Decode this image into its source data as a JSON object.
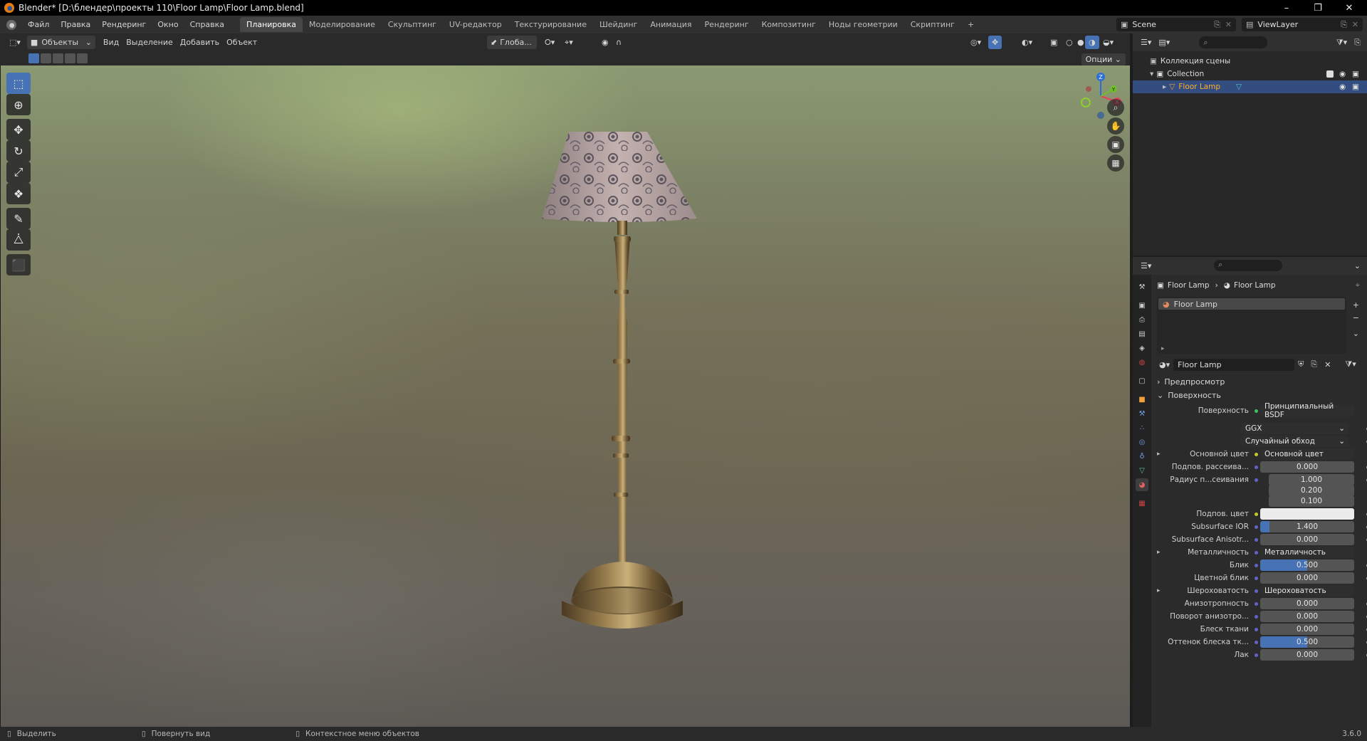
{
  "window": {
    "title": "Blender* [D:\\блендер\\проекты 110\\Floor Lamp\\Floor Lamp.blend]"
  },
  "menu": [
    "Файл",
    "Правка",
    "Рендеринг",
    "Окно",
    "Справка"
  ],
  "workspaces": [
    "Планировка",
    "Моделирование",
    "Скульптинг",
    "UV-редактор",
    "Текстурирование",
    "Шейдинг",
    "Анимация",
    "Рендеринг",
    "Композитинг",
    "Ноды геометрии",
    "Скриптинг"
  ],
  "active_workspace": "Планировка",
  "scene": {
    "name": "Scene",
    "view_layer": "ViewLayer"
  },
  "viewport_header": {
    "mode": "Объекты",
    "menus": [
      "Вид",
      "Выделение",
      "Добавить",
      "Объект"
    ],
    "orientation": "Глоба...",
    "options": "Опции"
  },
  "outliner": {
    "root": "Коллекция сцены",
    "collection": "Collection",
    "object": "Floor Lamp"
  },
  "properties": {
    "breadcrumb_object": "Floor Lamp",
    "breadcrumb_material": "Floor Lamp",
    "slot": "Floor Lamp",
    "material_name": "Floor Lamp",
    "sections": {
      "preview": "Предпросмотр",
      "surface": "Поверхность"
    },
    "surface_label": "Поверхность",
    "surface_shader": "Принципиальный BSDF",
    "distribution": "GGX",
    "subsurface_method": "Случайный обход",
    "rows": {
      "base_color_label": "Основной цвет",
      "base_color_value": "Основной цвет",
      "subsurface_label": "Подпов. рассеива...",
      "subsurface_value": "0.000",
      "radius_label": "Радиус п...сеивания",
      "radius_1": "1.000",
      "radius_2": "0.200",
      "radius_3": "0.100",
      "subsurface_color_label": "Подпов. цвет",
      "ior_label": "Subsurface IOR",
      "ior_value": "1.400",
      "aniso_label": "Subsurface Anisotr...",
      "aniso_value": "0.000",
      "metallic_label": "Металличность",
      "metallic_value": "Металличность",
      "specular_label": "Блик",
      "specular_value": "0.500",
      "spec_tint_label": "Цветной блик",
      "spec_tint_value": "0.000",
      "roughness_label": "Шероховатость",
      "roughness_value": "Шероховатость",
      "anisotropic_label": "Анизотропность",
      "anisotropic_value": "0.000",
      "aniso_rot_label": "Поворот анизотро...",
      "aniso_rot_value": "0.000",
      "sheen_label": "Блеск ткани",
      "sheen_value": "0.000",
      "sheen_tint_label": "Оттенок блеска тк...",
      "sheen_tint_value": "0.500",
      "clearcoat_label": "Лак",
      "clearcoat_value": "0.000"
    }
  },
  "status": {
    "select": "Выделить",
    "rotate": "Повернуть вид",
    "context_menu": "Контекстное меню объектов",
    "version": "3.6.0"
  },
  "colors": {
    "accent": "#4772b3",
    "selection": "#334d80"
  }
}
